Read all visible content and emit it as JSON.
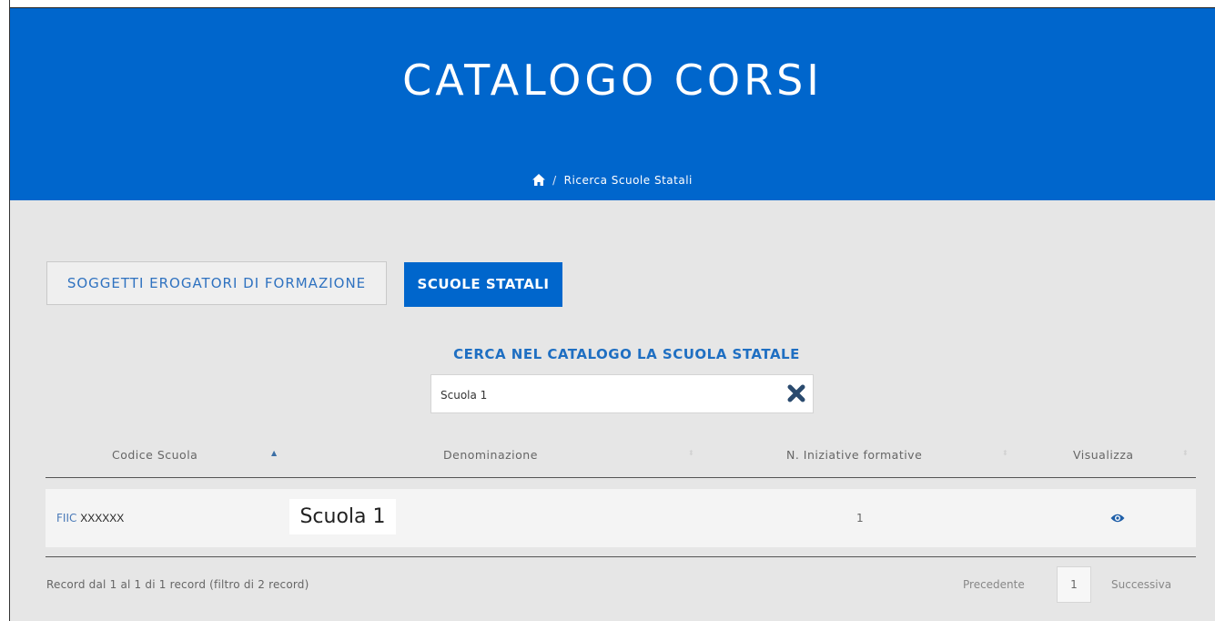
{
  "header": {
    "title": "CATALOGO CORSI",
    "breadcrumb_current": "Ricerca Scuole Statali",
    "breadcrumb_separator": "/"
  },
  "tabs": [
    {
      "label": "SOGGETTI EROGATORI DI FORMAZIONE",
      "active": false
    },
    {
      "label": "SCUOLE STATALI",
      "active": true
    }
  ],
  "search": {
    "label": "CERCA NEL CATALOGO LA SCUOLA STATALE",
    "value": "Scuola 1"
  },
  "table": {
    "columns": [
      "Codice Scuola",
      "Denominazione",
      "N. Iniziative formative",
      "Visualizza"
    ],
    "sorted_column": "Codice Scuola",
    "rows": [
      {
        "code_prefix": "FIIC",
        "code": "XXXXXX",
        "name": "Scuola 1",
        "iniziative": "1",
        "action_icon": "eye-icon"
      }
    ]
  },
  "footer": {
    "summary": "Record dal 1 al 1 di 1 record (filtro di 2 record)",
    "prev_label": "Precedente",
    "current_page": "1",
    "next_label": "Successiva"
  },
  "colors": {
    "brand_blue": "#0066cc",
    "content_bg": "#e6e6e6"
  }
}
